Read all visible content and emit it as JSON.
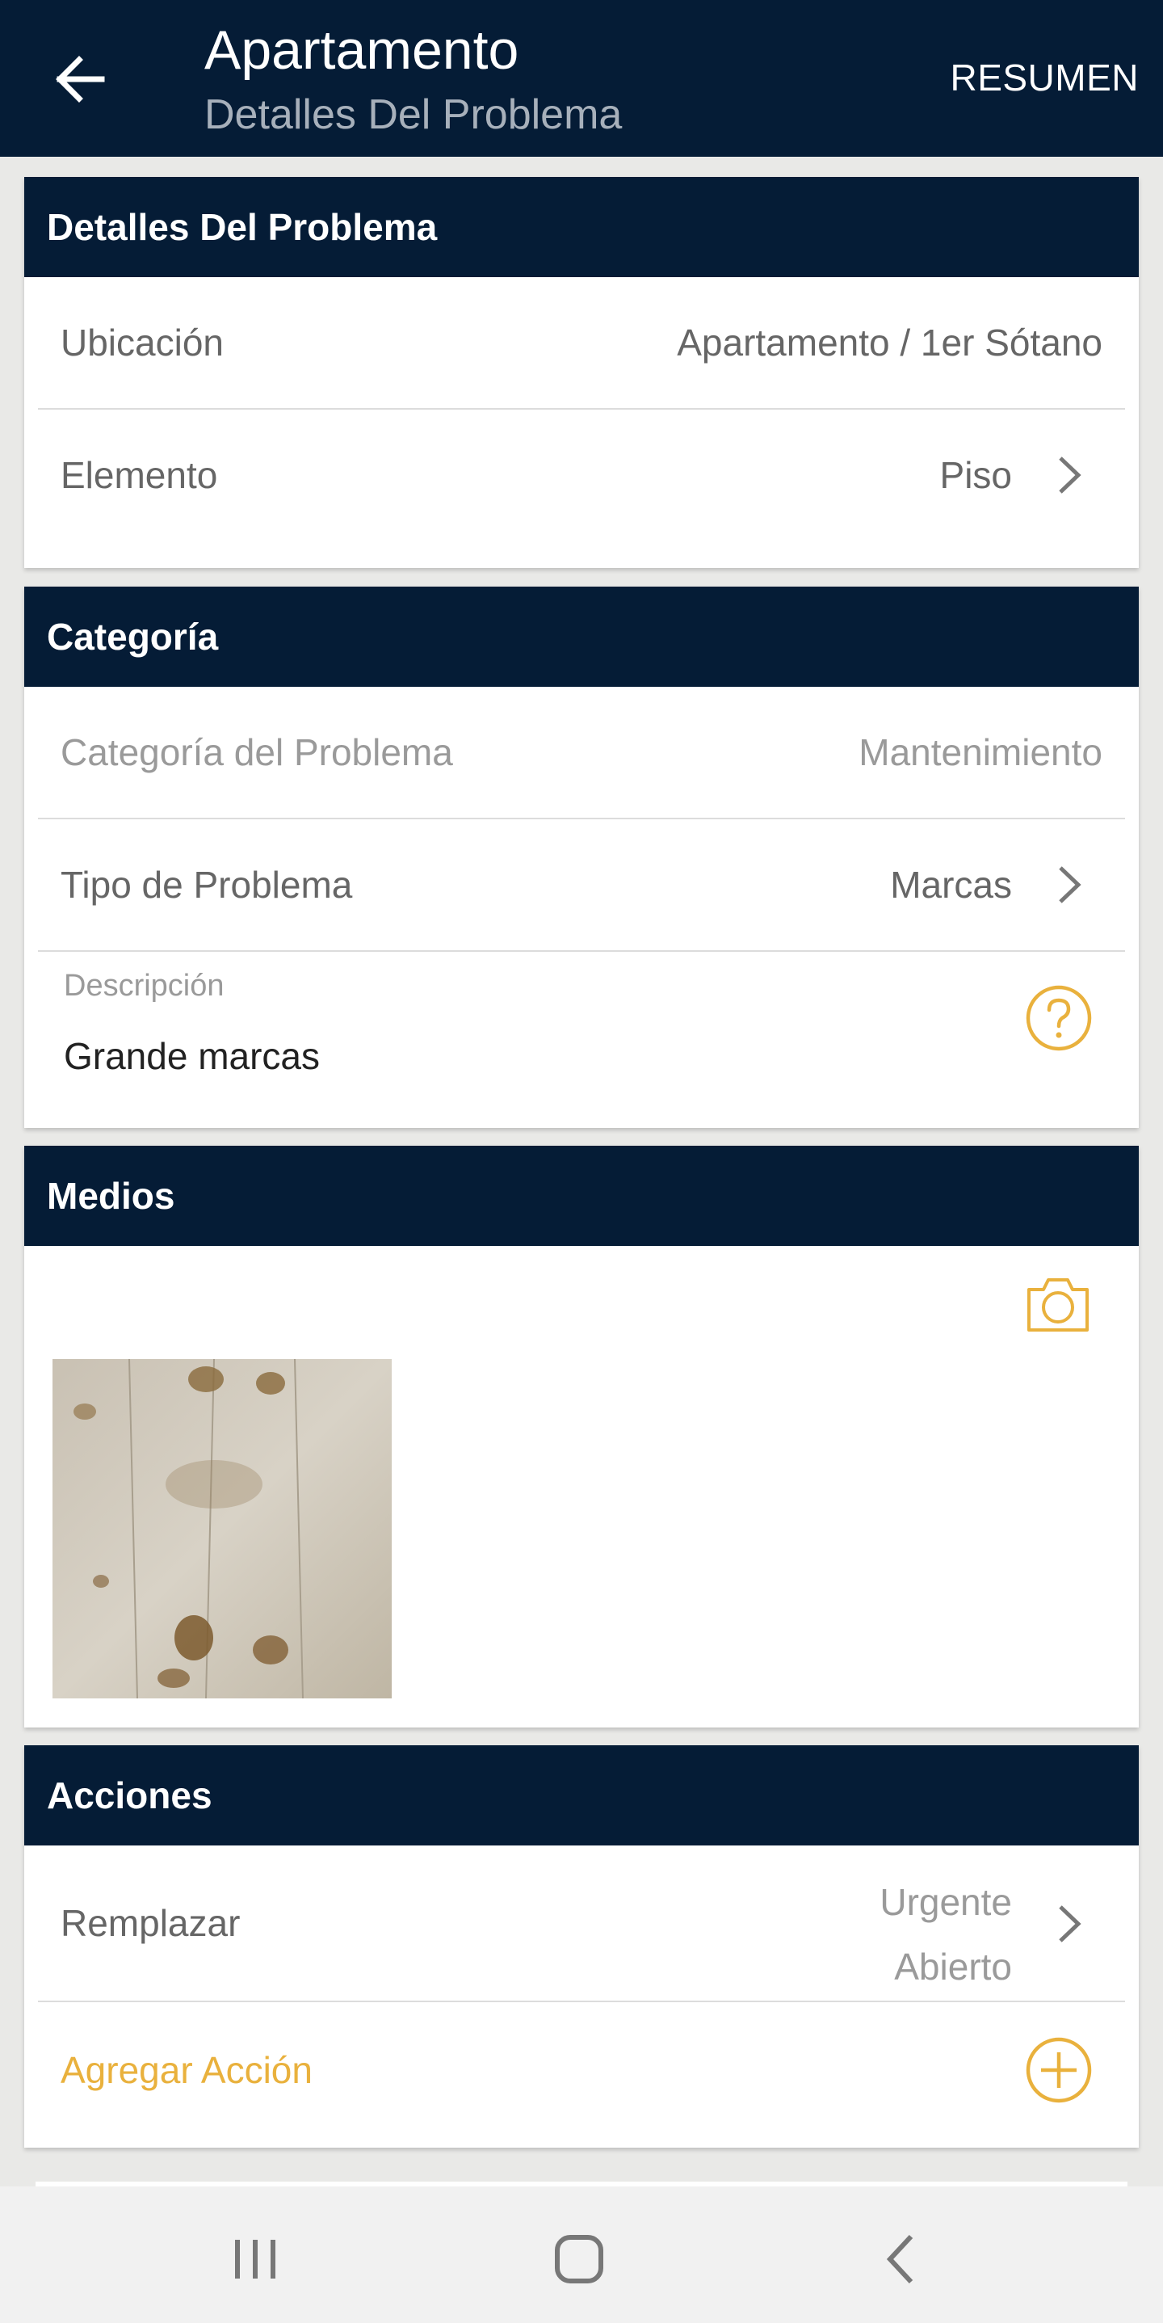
{
  "appbar": {
    "title": "Apartamento",
    "subtitle": "Detalles Del Problema",
    "action_label": "RESUMEN",
    "back_icon": "arrow-left-icon"
  },
  "details": {
    "header": "Detalles Del Problema",
    "rows": [
      {
        "label": "Ubicación",
        "value": "Apartamento / 1er Sótano"
      },
      {
        "label": "Elemento",
        "value": "Piso"
      }
    ]
  },
  "category": {
    "header": "Categoría",
    "rows": [
      {
        "label": "Categoría del Problema",
        "value": "Mantenimiento"
      },
      {
        "label": "Tipo de Problema",
        "value": "Marcas"
      }
    ],
    "description_label": "Descripción",
    "description_value": "Grande marcas"
  },
  "media": {
    "header": "Medios",
    "photo_alt": "wooden floor with marks"
  },
  "actions": {
    "header": "Acciones",
    "item_label": "Remplazar",
    "item_priority": "Urgente",
    "item_status": "Abierto",
    "add_label": "Agregar Acción"
  },
  "colors": {
    "primary_dark": "#051c36",
    "accent": "#e9b13d"
  }
}
